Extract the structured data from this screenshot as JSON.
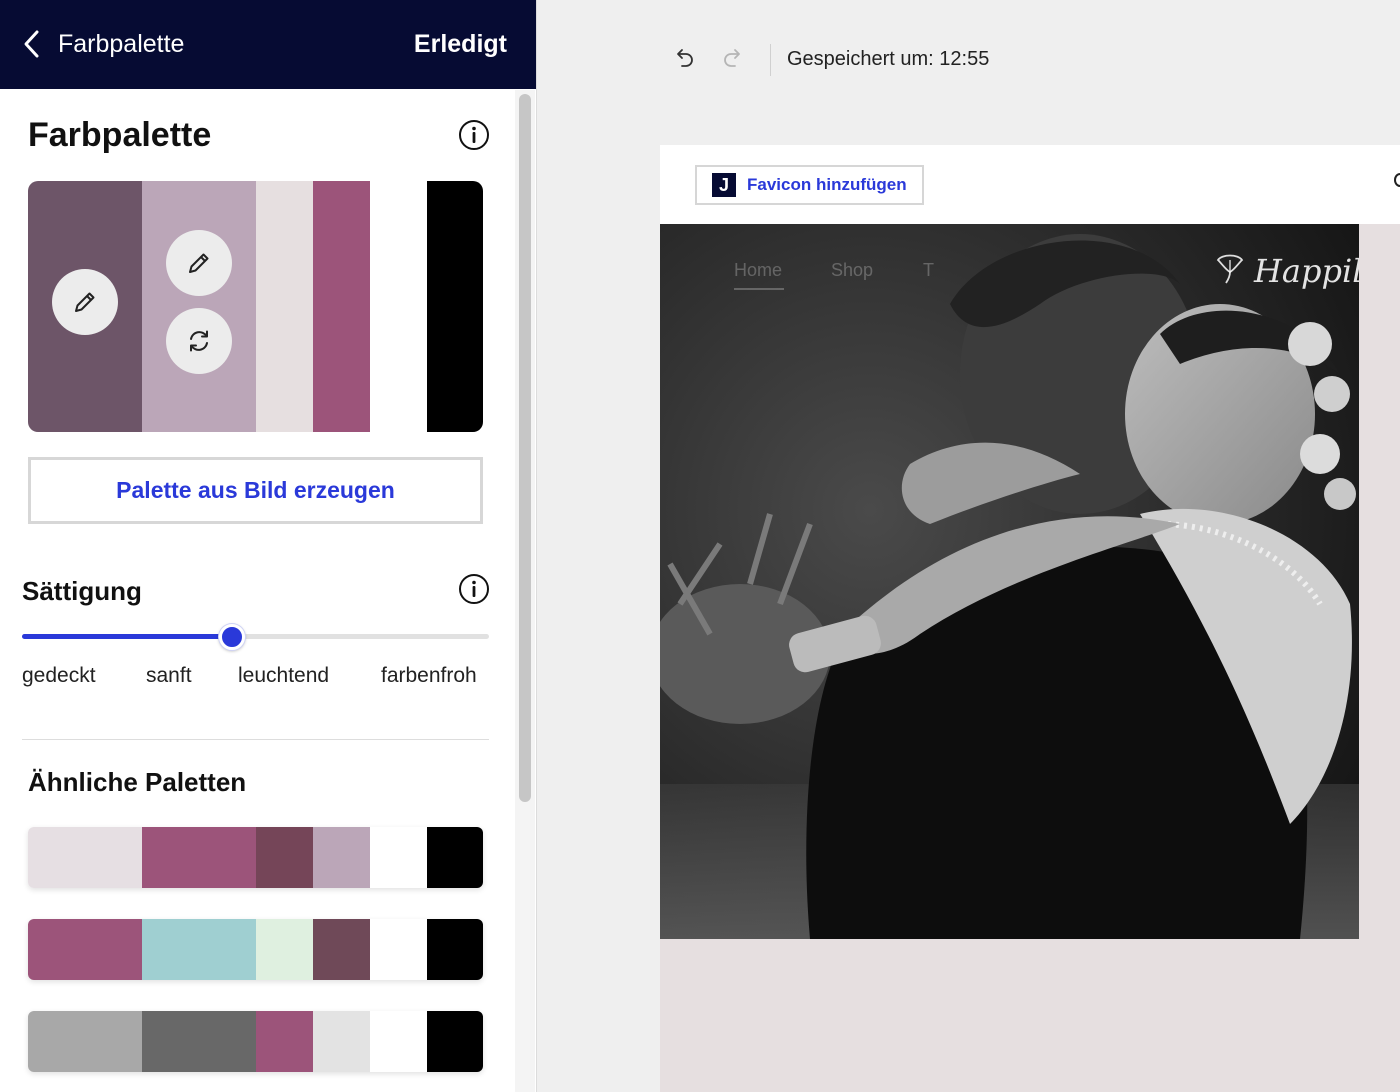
{
  "topbar": {
    "title": "Farbpalette",
    "done_label": "Erledigt"
  },
  "palette_section": {
    "title": "Farbpalette",
    "colors": [
      "#6d5568",
      "#bba6b8",
      "#e6dfe0",
      "#9c547a",
      "#ffffff",
      "#000000"
    ],
    "generate_label": "Palette aus Bild erzeugen"
  },
  "saturation": {
    "title": "Sättigung",
    "value_fraction": 0.45,
    "labels": [
      "gedeckt",
      "sanft",
      "leuchtend",
      "farbenfroh"
    ]
  },
  "similar": {
    "title": "Ähnliche Paletten",
    "palettes": [
      [
        "#e6dfe3",
        "#9c547a",
        "#754558",
        "#bba6b8",
        "#ffffff",
        "#000000"
      ],
      [
        "#9c547a",
        "#9fcfd1",
        "#dff0e0",
        "#6f4958",
        "#ffffff",
        "#000000"
      ],
      [
        "#a8a8a8",
        "#686868",
        "#9c547a",
        "#e3e3e3",
        "#ffffff",
        "#000000"
      ]
    ]
  },
  "editor": {
    "saved_text": "Gespeichert um: 12:55",
    "favicon_label": "Favicon hinzufügen",
    "favicon_logo": "J",
    "nav": [
      "Home",
      "Shop",
      "T"
    ],
    "brand": "Happily Ev"
  }
}
